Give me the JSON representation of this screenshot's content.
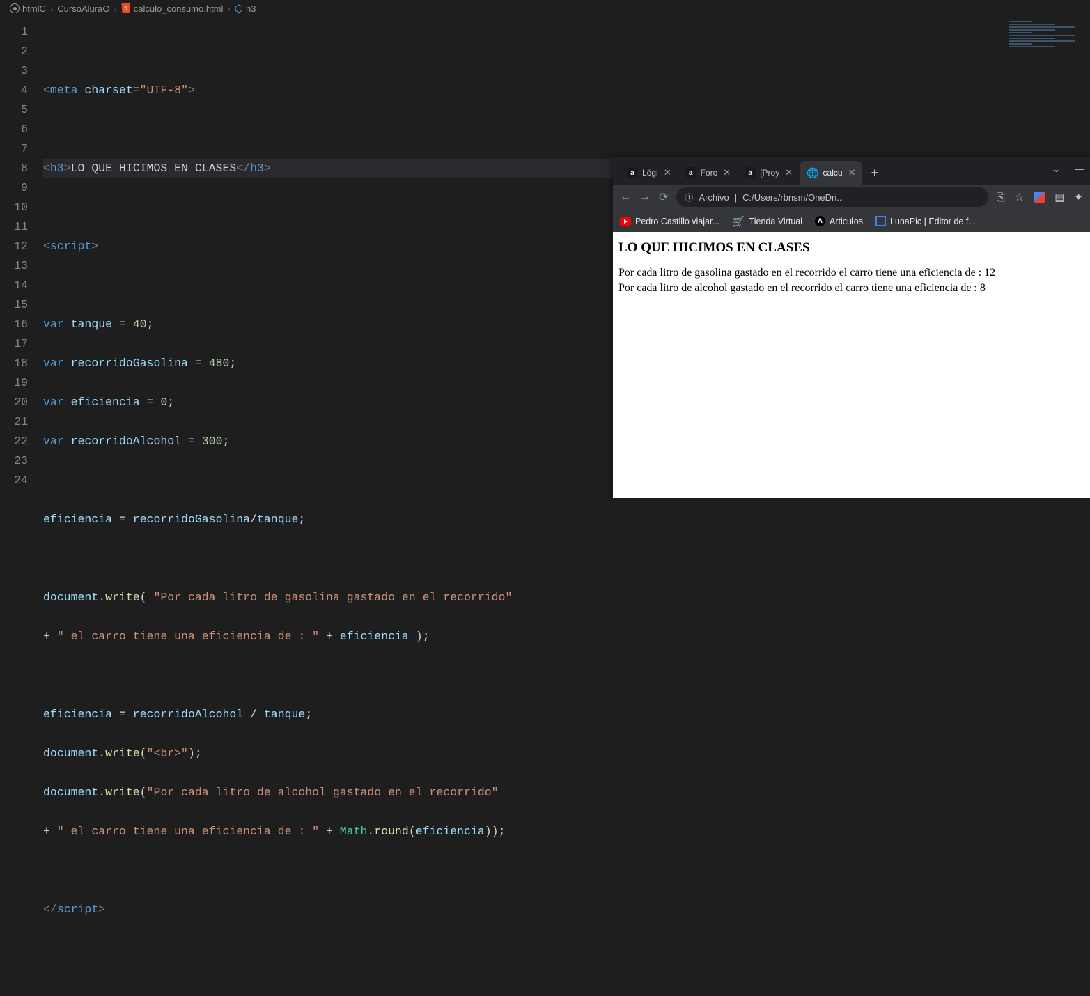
{
  "breadcrumb": {
    "part1": "htmlC",
    "part2": "CursoAluraO",
    "part3": "calculo_consumo.html",
    "part4": "h3"
  },
  "editor": {
    "lines": [
      {
        "n": 1,
        "raw": ""
      },
      {
        "n": 2,
        "raw": "<meta charset=\"UTF-8\">"
      },
      {
        "n": 3,
        "raw": ""
      },
      {
        "n": 4,
        "raw": "<h3>LO QUE HICIMOS EN CLASES</h3>",
        "hl": true
      },
      {
        "n": 5,
        "raw": ""
      },
      {
        "n": 6,
        "raw": "<script>"
      },
      {
        "n": 7,
        "raw": ""
      },
      {
        "n": 8,
        "raw": "var tanque = 40;"
      },
      {
        "n": 9,
        "raw": "var recorridoGasolina = 480;"
      },
      {
        "n": 10,
        "raw": "var eficiencia = 0;"
      },
      {
        "n": 11,
        "raw": "var recorridoAlcohol = 300;"
      },
      {
        "n": 12,
        "raw": ""
      },
      {
        "n": 13,
        "raw": "eficiencia = recorridoGasolina/tanque;"
      },
      {
        "n": 14,
        "raw": ""
      },
      {
        "n": 15,
        "raw": "document.write( \"Por cada litro de gasolina gastado en el recorrido\""
      },
      {
        "n": 16,
        "raw": "+ \" el carro tiene una eficiencia de : \" + eficiencia );"
      },
      {
        "n": 17,
        "raw": ""
      },
      {
        "n": 18,
        "raw": "eficiencia = recorridoAlcohol / tanque;"
      },
      {
        "n": 19,
        "raw": "document.write(\"<br>\");"
      },
      {
        "n": 20,
        "raw": "document.write(\"Por cada litro de alcohol gastado en el recorrido\""
      },
      {
        "n": 21,
        "raw": "+ \" el carro tiene una eficiencia de : \" + Math.round(eficiencia));"
      },
      {
        "n": 22,
        "raw": ""
      },
      {
        "n": 23,
        "raw": "</script>"
      },
      {
        "n": 24,
        "raw": ""
      }
    ],
    "tok": {
      "t2_meta": "meta",
      "t2_charset": "charset",
      "t2_val": "\"UTF-8\"",
      "t4_h3o": "h3",
      "t4_txt": "LO QUE HICIMOS EN CLASES",
      "t4_h3c": "h3",
      "t6_script": "script",
      "var_kw": "var",
      "v_tanque": "tanque",
      "n_40": "40",
      "v_rg": "recorridoGasolina",
      "n_480": "480",
      "v_ef": "eficiencia",
      "n_0": "0",
      "v_ra": "recorridoAlcohol",
      "n_300": "300",
      "v_doc": "document",
      "f_write": "write",
      "s15": "\"Por cada litro de gasolina gastado en el recorrido\"",
      "s16": "\" el carro tiene una eficiencia de : \"",
      "s19": "\"<br>\"",
      "s20": "\"Por cada litro de alcohol gastado en el recorrido\"",
      "s21": "\" el carro tiene una eficiencia de : \"",
      "v_math": "Math",
      "f_round": "round",
      "t23_script": "script"
    }
  },
  "browser": {
    "tabs": [
      {
        "label": "Lógi"
      },
      {
        "label": "Foro"
      },
      {
        "label": "[Proy"
      },
      {
        "label": "calcu",
        "active": true
      }
    ],
    "newtab": "+",
    "controls": {
      "chevron": "⌄",
      "minimize": "—"
    },
    "address": {
      "scheme": "Archivo",
      "sep": "|",
      "path": "C:/Users/rbnsm/OneDri..."
    },
    "nav_icons": {
      "back": "←",
      "forward": "→",
      "reload": "⟳"
    },
    "act_icons": {
      "share": "⎘",
      "star": "☆",
      "pdf": "▤",
      "ext": "✦",
      "more": "⋮"
    },
    "bookmarks": [
      {
        "label": "Pedro Castillo viajar...",
        "type": "yt"
      },
      {
        "label": "Tienda Virtual",
        "type": "cart"
      },
      {
        "label": "Articulos",
        "type": "ang"
      },
      {
        "label": "LunaPic | Editor de f...",
        "type": "luna"
      }
    ],
    "page": {
      "heading": "LO QUE HICIMOS EN CLASES",
      "line1": "Por cada litro de gasolina gastado en el recorrido el carro tiene una eficiencia de : 12",
      "line2": "Por cada litro de alcohol gastado en el recorrido el carro tiene una eficiencia de : 8"
    }
  }
}
